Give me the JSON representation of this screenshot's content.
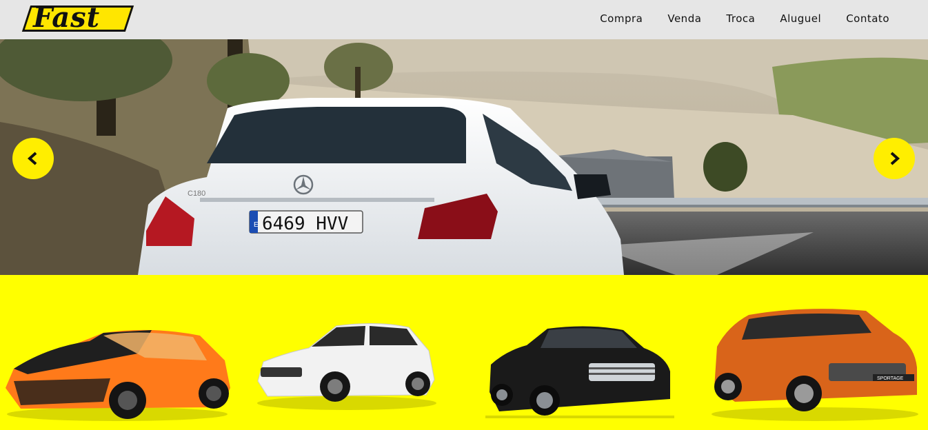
{
  "brand": {
    "logo_text": "Fast"
  },
  "nav": {
    "items": [
      {
        "label": "Compra"
      },
      {
        "label": "Venda"
      },
      {
        "label": "Troca"
      },
      {
        "label": "Aluguel"
      },
      {
        "label": "Contato"
      }
    ]
  },
  "hero": {
    "slide": "white-sedan-on-country-road",
    "badge_text": "C180",
    "plate_text": "6469 HVV",
    "plate_region": "E",
    "prev_icon": "chevron-left-icon",
    "next_icon": "chevron-right-icon"
  },
  "featured_cars": [
    {
      "name": "orange-coupe",
      "color": "#ff7a1a"
    },
    {
      "name": "white-hatchback",
      "color": "#f2f2f2"
    },
    {
      "name": "black-sedan",
      "color": "#1a1a1a"
    },
    {
      "name": "orange-suv",
      "color": "#d9641a",
      "badge": "SPORTAGE"
    }
  ],
  "colors": {
    "accent": "#ffff00",
    "header_bg": "#e6e6e6",
    "arrow_bg": "#ffee00"
  }
}
